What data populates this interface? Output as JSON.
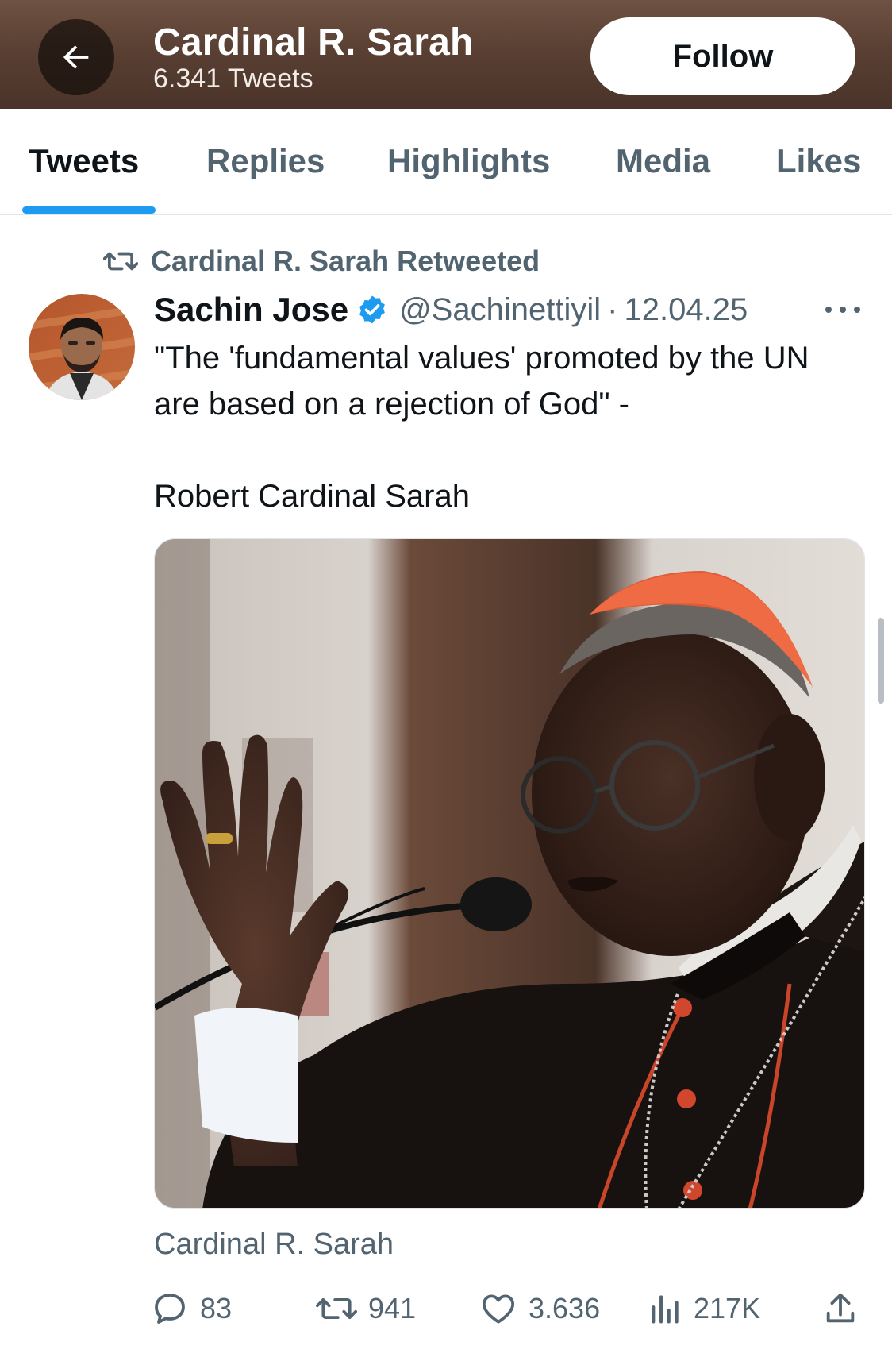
{
  "header": {
    "title": "Cardinal R. Sarah",
    "subtitle": "6.341 Tweets",
    "follow_label": "Follow"
  },
  "tabs": [
    {
      "label": "Tweets",
      "active": true
    },
    {
      "label": "Replies",
      "active": false
    },
    {
      "label": "Highlights",
      "active": false
    },
    {
      "label": "Media",
      "active": false
    },
    {
      "label": "Likes",
      "active": false
    }
  ],
  "tweet": {
    "retweeted_by": "Cardinal R. Sarah Retweeted",
    "author_name": "Sachin Jose",
    "verified": true,
    "handle": "@Sachinettiyil",
    "separator": "·",
    "date": "12.04.25",
    "text_line1": "\"The 'fundamental values' promoted by the UN are based on a rejection of God\" -",
    "text_line2": "Robert Cardinal Sarah",
    "card_caption": "Cardinal R. Sarah",
    "stats": {
      "replies": "83",
      "retweets": "941",
      "likes": "3.636",
      "views": "217K"
    }
  },
  "colors": {
    "accent": "#1d9bf0",
    "secondary_text": "#536471",
    "header_bg": "#5a4033"
  },
  "icons": [
    "back-arrow-icon",
    "retweet-icon",
    "verified-badge-icon",
    "more-icon",
    "reply-icon",
    "like-icon",
    "views-icon",
    "share-icon"
  ]
}
